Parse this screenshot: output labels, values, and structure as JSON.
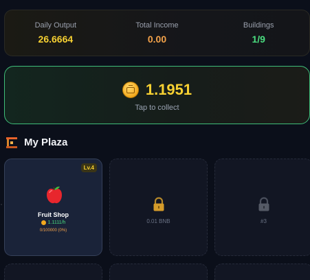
{
  "stats": [
    {
      "label": "Daily Output",
      "value": "26.6664",
      "color": "#f7d132"
    },
    {
      "label": "Total Income",
      "value": "0.00",
      "color": "#f5a34a"
    },
    {
      "label": "Buildings",
      "value": "1/9",
      "color": "#4ade80"
    }
  ],
  "collect": {
    "amount": "1.1951",
    "hint": "Tap to collect",
    "icon": "coin-icon"
  },
  "section": {
    "title": "My Plaza",
    "icon": "plaza-icon"
  },
  "plaza": {
    "slots": [
      {
        "type": "building",
        "name": "Fruit Shop",
        "level": "Lv.4",
        "rate": "1.1111/h",
        "progress": "0/100000 (0%)",
        "icon": "apple-icon"
      },
      {
        "type": "locked",
        "label": "0.01 BNB",
        "icon": "lock-icon"
      },
      {
        "type": "locked",
        "label": "#3",
        "icon": "lock-icon"
      }
    ]
  },
  "colors": {
    "accent_yellow": "#f7d132",
    "accent_green": "#4ade80",
    "accent_orange": "#f5a34a"
  }
}
